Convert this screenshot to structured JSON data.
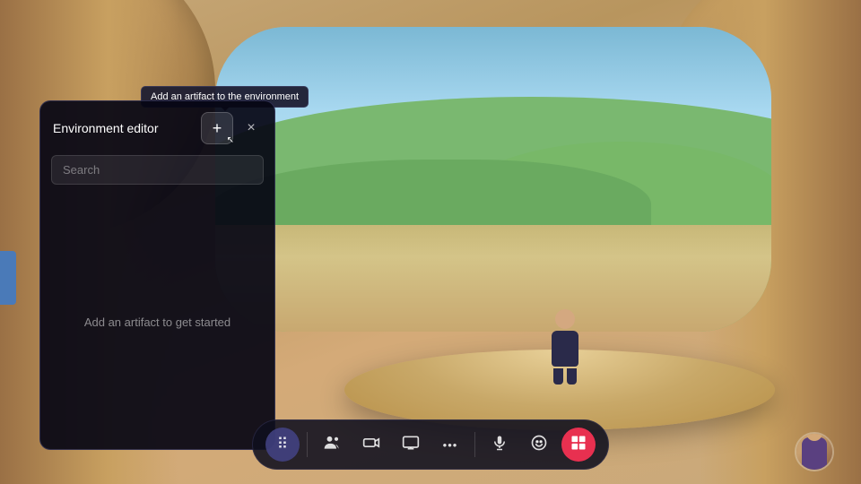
{
  "background": {
    "description": "VR environment with sandy interior and green landscape window"
  },
  "tooltip": {
    "text": "Add an artifact to the environment"
  },
  "panel": {
    "title": "Environment editor",
    "add_button_label": "+",
    "close_button_label": "×",
    "search_placeholder": "Search",
    "empty_state_text": "Add an artifact to get started"
  },
  "toolbar": {
    "buttons": [
      {
        "id": "apps",
        "icon": "⠿",
        "label": "Apps"
      },
      {
        "id": "people",
        "icon": "👥",
        "label": "People"
      },
      {
        "id": "camera",
        "icon": "🎥",
        "label": "Camera"
      },
      {
        "id": "share",
        "icon": "📋",
        "label": "Share"
      },
      {
        "id": "more",
        "icon": "•••",
        "label": "More"
      },
      {
        "id": "mic",
        "icon": "🎤",
        "label": "Microphone"
      },
      {
        "id": "emoji",
        "icon": "🙂",
        "label": "Emoji"
      },
      {
        "id": "view",
        "icon": "⊞",
        "label": "View",
        "active": true
      }
    ]
  }
}
